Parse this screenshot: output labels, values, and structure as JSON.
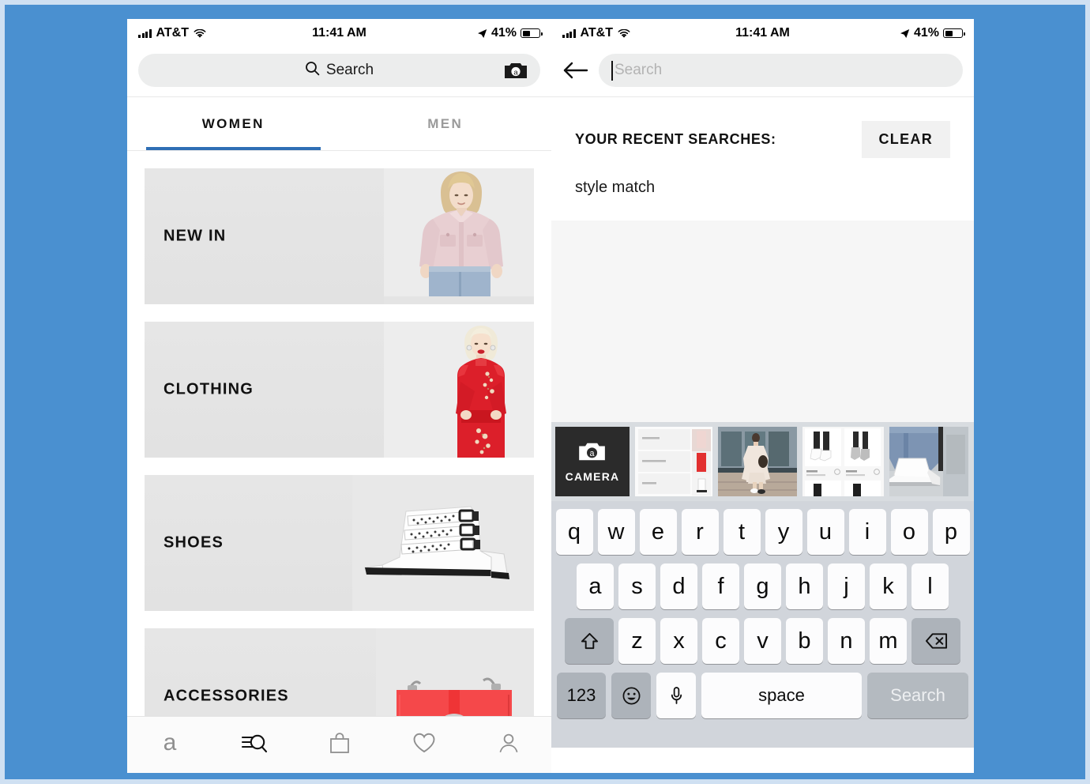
{
  "theme": {
    "page_bg": "#4a90d0",
    "accent_blue": "#2f6fb5",
    "card_gray": "#e4e4e4",
    "keyboard_bg": "#d1d5db"
  },
  "status_bar": {
    "carrier": "AT&T",
    "time": "11:41 AM",
    "battery_percent": "41%",
    "signal_icon": "signal-bars-icon",
    "wifi_icon": "wifi-icon",
    "location_icon": "location-arrow-icon",
    "battery_icon": "battery-icon"
  },
  "left_phone": {
    "search_bar": {
      "label": "Search",
      "search_icon": "search-icon",
      "camera_icon": "camera-icon"
    },
    "tabs": [
      {
        "label": "WOMEN",
        "active": true
      },
      {
        "label": "MEN",
        "active": false
      }
    ],
    "categories": [
      {
        "label": "NEW IN",
        "art": "pink-jacket-model"
      },
      {
        "label": "CLOTHING",
        "art": "red-dress-model"
      },
      {
        "label": "SHOES",
        "art": "white-studded-boot"
      },
      {
        "label": "ACCESSORIES",
        "art": "red-handbag"
      }
    ],
    "bottom_nav": [
      {
        "name": "home",
        "icon": "asos-a-logo-icon",
        "active": false
      },
      {
        "name": "search",
        "icon": "search-lines-icon",
        "active": true
      },
      {
        "name": "bag",
        "icon": "shopping-bag-icon",
        "active": false
      },
      {
        "name": "saved",
        "icon": "heart-icon",
        "active": false
      },
      {
        "name": "account",
        "icon": "person-icon",
        "active": false
      }
    ]
  },
  "right_phone": {
    "header": {
      "back_icon": "back-arrow-icon",
      "search_placeholder": "Search",
      "search_value": ""
    },
    "recent": {
      "title": "YOUR RECENT SEARCHES:",
      "clear_label": "CLEAR",
      "items": [
        "style match"
      ]
    },
    "photo_strip": {
      "camera_label": "CAMERA",
      "camera_icon": "camera-icon",
      "thumbnails": [
        "product-list-screenshot",
        "street-style-dress-photo",
        "boots-product-grid-screenshot",
        "white-ankle-boot-photo",
        "partial-thumbnail"
      ]
    },
    "keyboard": {
      "row1": [
        "q",
        "w",
        "e",
        "r",
        "t",
        "y",
        "u",
        "i",
        "o",
        "p"
      ],
      "row2": [
        "a",
        "s",
        "d",
        "f",
        "g",
        "h",
        "j",
        "k",
        "l"
      ],
      "row3": [
        "z",
        "x",
        "c",
        "v",
        "b",
        "n",
        "m"
      ],
      "shift_icon": "shift-arrow-icon",
      "delete_icon": "backspace-icon",
      "num_label": "123",
      "emoji_icon": "emoji-smiley-icon",
      "mic_icon": "microphone-icon",
      "space_label": "space",
      "search_label": "Search"
    }
  }
}
